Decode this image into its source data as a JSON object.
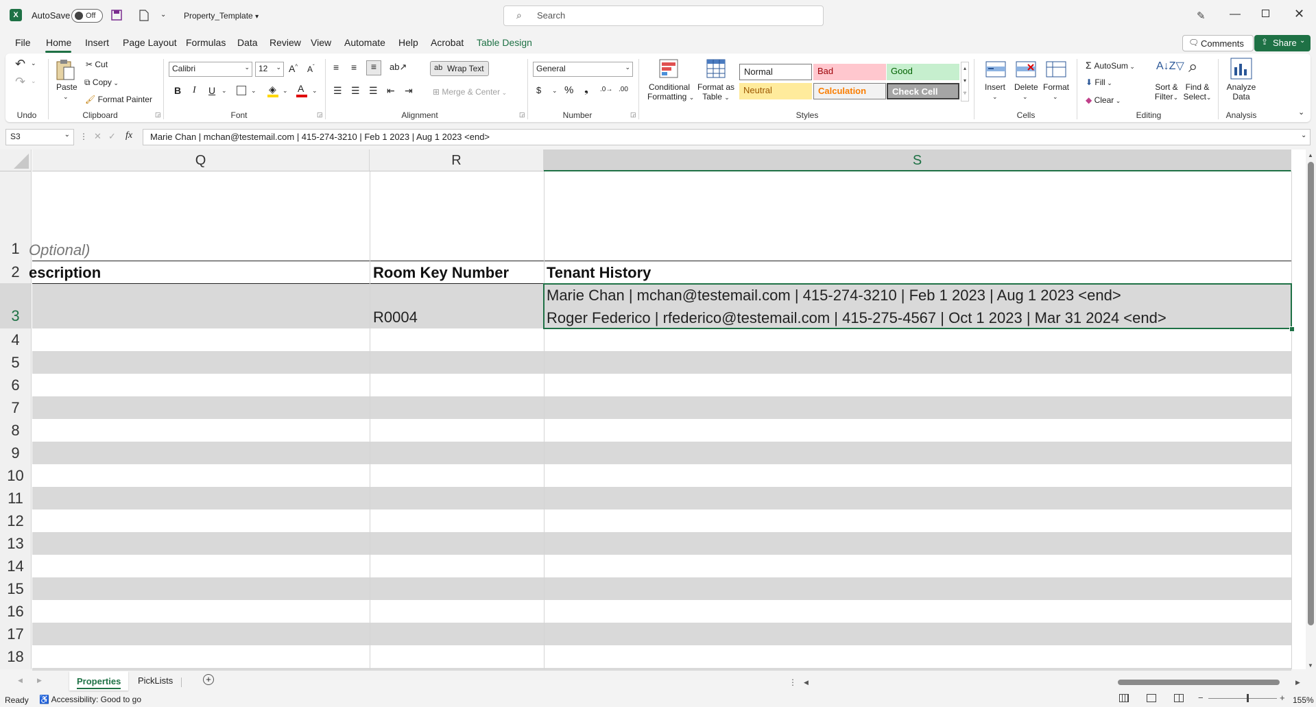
{
  "titlebar": {
    "autosave_label": "AutoSave",
    "autosave_state": "Off",
    "file_name": "Property_Template",
    "search_placeholder": "Search"
  },
  "menu": {
    "tabs": [
      "File",
      "Home",
      "Insert",
      "Page Layout",
      "Formulas",
      "Data",
      "Review",
      "View",
      "Automate",
      "Help",
      "Acrobat",
      "Table Design"
    ],
    "active": "Home",
    "comments": "Comments",
    "share": "Share"
  },
  "ribbon": {
    "undo_group": "Undo",
    "clipboard": {
      "label": "Clipboard",
      "paste": "Paste",
      "cut": "Cut",
      "copy": "Copy",
      "format_painter": "Format Painter"
    },
    "font": {
      "label": "Font",
      "name": "Calibri",
      "size": "12"
    },
    "alignment": {
      "label": "Alignment",
      "wrap_text": "Wrap Text",
      "merge_center": "Merge & Center"
    },
    "number": {
      "label": "Number",
      "format": "General"
    },
    "styles": {
      "label": "Styles",
      "conditional_formatting": [
        "Conditional",
        "Formatting"
      ],
      "format_as_table": [
        "Format as",
        "Table"
      ],
      "normal": "Normal",
      "bad": "Bad",
      "good": "Good",
      "neutral": "Neutral",
      "calculation": "Calculation",
      "check_cell": "Check Cell"
    },
    "cells": {
      "label": "Cells",
      "insert": "Insert",
      "delete": "Delete",
      "format": "Format"
    },
    "editing": {
      "label": "Editing",
      "autosum": "AutoSum",
      "fill": "Fill",
      "clear": "Clear",
      "sort_filter": [
        "Sort &",
        "Filter"
      ],
      "find_select": [
        "Find &",
        "Select"
      ]
    },
    "analysis": {
      "label": "Analysis",
      "analyze_data": [
        "Analyze",
        "Data"
      ]
    }
  },
  "formula_bar": {
    "name_box": "S3",
    "fx": "fx",
    "content": "Marie Chan | mchan@testemail.com | 415-274-3210 | Feb 1 2023 | Aug 1 2023 <end>"
  },
  "grid": {
    "columns": [
      "Q",
      "R",
      "S"
    ],
    "selected_column": "S",
    "rows": [
      "1",
      "2",
      "3",
      "4",
      "5",
      "6",
      "7",
      "8",
      "9",
      "10",
      "11",
      "12",
      "13",
      "14",
      "15",
      "16",
      "17",
      "18"
    ],
    "selected_row": "3",
    "q1_text": "Optional)",
    "headers": {
      "q": "escription",
      "r": "Room Key Number",
      "s": "Tenant History"
    },
    "r3": "R0004",
    "s3_line1": "Marie Chan | mchan@testemail.com | 415-274-3210 | Feb 1 2023 | Aug 1 2023 <end>",
    "s3_line2": "Roger Federico | rfederico@testemail.com | 415-275-4567 | Oct 1 2023 | Mar 31 2024 <end>"
  },
  "sheets": {
    "tabs": [
      "Properties",
      "PickLists"
    ],
    "active": "Properties"
  },
  "status": {
    "ready": "Ready",
    "accessibility": "Accessibility: Good to go",
    "zoom": "155%"
  },
  "colors": {
    "accent": "#1e7145",
    "band": "#d9d9d9"
  }
}
